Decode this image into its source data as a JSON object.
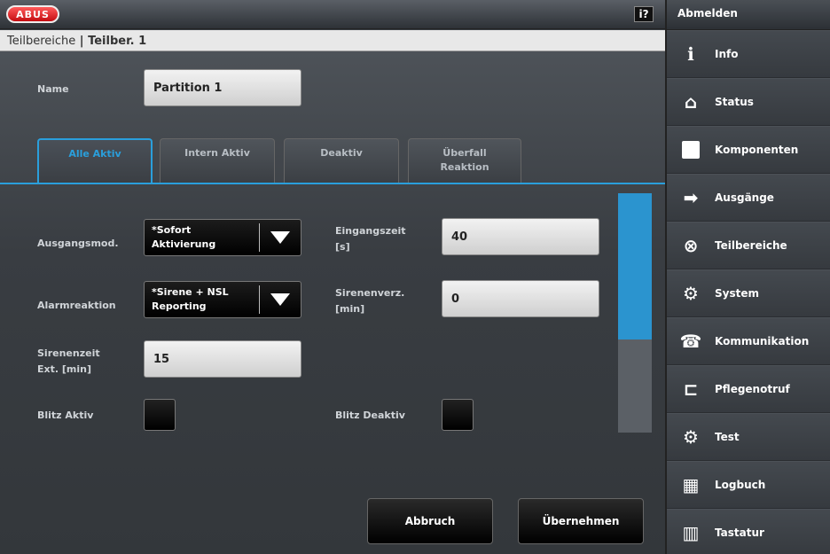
{
  "header": {
    "logo": "ABUS",
    "help_icon": "i?"
  },
  "breadcrumb": {
    "parent": "Teilbereiche",
    "separator": " | ",
    "current": "Teilber. 1"
  },
  "name": {
    "label": "Name",
    "value": "Partition 1"
  },
  "tabs": [
    {
      "line1": "Alle Aktiv",
      "line2": ""
    },
    {
      "line1": "Intern Aktiv",
      "line2": ""
    },
    {
      "line1": "Deaktiv",
      "line2": ""
    },
    {
      "line1": "Überfall",
      "line2": "Reaktion"
    }
  ],
  "fields": {
    "ausgangsmod": {
      "label": "Ausgangsmod.",
      "line1": "*Sofort",
      "line2": "Aktivierung"
    },
    "alarmreaktion": {
      "label": "Alarmreaktion",
      "line1": "*Sirene + NSL",
      "line2": "Reporting"
    },
    "sirenenzeit": {
      "label1": "Sirenenzeit",
      "label2": "Ext. [min]",
      "value": "15"
    },
    "eingangszeit": {
      "label1": "Eingangszeit",
      "label2": "[s]",
      "value": "40"
    },
    "sirenenverz": {
      "label1": "Sirenenverz.",
      "label2": "[min]",
      "value": "0"
    },
    "blitz_aktiv": {
      "label": "Blitz Aktiv"
    },
    "blitz_deaktiv": {
      "label": "Blitz Deaktiv"
    }
  },
  "buttons": {
    "cancel": "Abbruch",
    "apply": "Übernehmen"
  },
  "sidebar": {
    "logout": "Abmelden",
    "items": [
      {
        "label": "Info",
        "icon": "info-icon"
      },
      {
        "label": "Status",
        "icon": "house-icon"
      },
      {
        "label": "Komponenten",
        "icon": "square-icon"
      },
      {
        "label": "Ausgänge",
        "icon": "exit-arrow-icon"
      },
      {
        "label": "Teilbereiche",
        "icon": "partition-icon"
      },
      {
        "label": "System",
        "icon": "gears-icon"
      },
      {
        "label": "Kommunikation",
        "icon": "telephone-icon"
      },
      {
        "label": "Pflegenotruf",
        "icon": "bed-icon"
      },
      {
        "label": "Test",
        "icon": "gears-icon"
      },
      {
        "label": "Logbuch",
        "icon": "calendar-icon"
      },
      {
        "label": "Tastatur",
        "icon": "keypad-icon"
      }
    ]
  },
  "colors": {
    "accent": "#2a9fdc",
    "logo_red": "#c40d12"
  }
}
